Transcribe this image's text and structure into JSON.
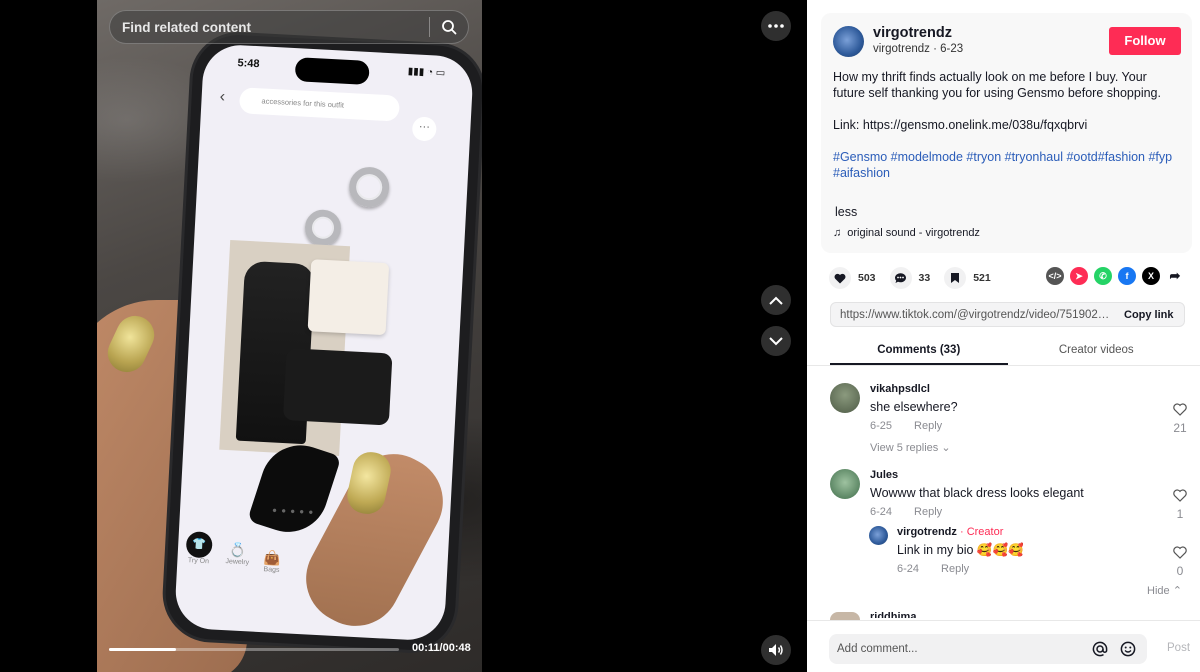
{
  "video": {
    "search_placeholder": "Find related content",
    "time": "00:11/00:48",
    "progress": 0.23,
    "phone_screen": {
      "clock": "5:48",
      "search_text": "accessories for this outfit",
      "tabs": [
        "Try On",
        "Jewelry",
        "Bags"
      ]
    }
  },
  "post": {
    "author": "virgotrendz",
    "author_sub": "virgotrendz · 6-23",
    "follow_label": "Follow",
    "description_1": "How my thrift finds actually look on me before I buy. Your future self thanking you for using Gensmo before shopping.",
    "description_2": "Link: https://gensmo.onelink.me/038u/fqxqbrvi",
    "hashtags": "#Gensmo #modelmode #tryon #tryonhaul #ootd#fashion #fyp #aifashion",
    "less_label": "less",
    "sound": "original sound - virgotrendz"
  },
  "stats": {
    "likes": "503",
    "comments": "33",
    "saves": "521"
  },
  "share_icons": [
    "embed-icon",
    "send-icon",
    "whatsapp-icon",
    "facebook-icon",
    "x-icon",
    "share-arrow-icon"
  ],
  "link": {
    "url": "https://www.tiktok.com/@virgotrendz/video/75190207...",
    "copy_label": "Copy link"
  },
  "tabs": {
    "comments": "Comments (33)",
    "creator_videos": "Creator videos"
  },
  "comments": [
    {
      "user": "vikahpsdlcl",
      "text": "she elsewhere?",
      "date": "6-25",
      "reply": "Reply",
      "likes": "21"
    },
    {
      "user": "Jules",
      "text": "Wowww that black dress looks elegant",
      "date": "6-24",
      "reply": "Reply",
      "likes": "1"
    }
  ],
  "view_replies": "View 5 replies",
  "reply": {
    "user": "virgotrendz",
    "badge": "· Creator",
    "text": "Link in my bio 🥰🥰🥰",
    "date": "6-24",
    "reply": "Reply",
    "likes": "0"
  },
  "hide_label": "Hide",
  "next_comment_user": "riddhima",
  "add_comment_placeholder": "Add comment...",
  "post_label": "Post",
  "colors": {
    "accent": "#fe2c55",
    "hashtag": "#2b5db9",
    "background": "#000000"
  }
}
